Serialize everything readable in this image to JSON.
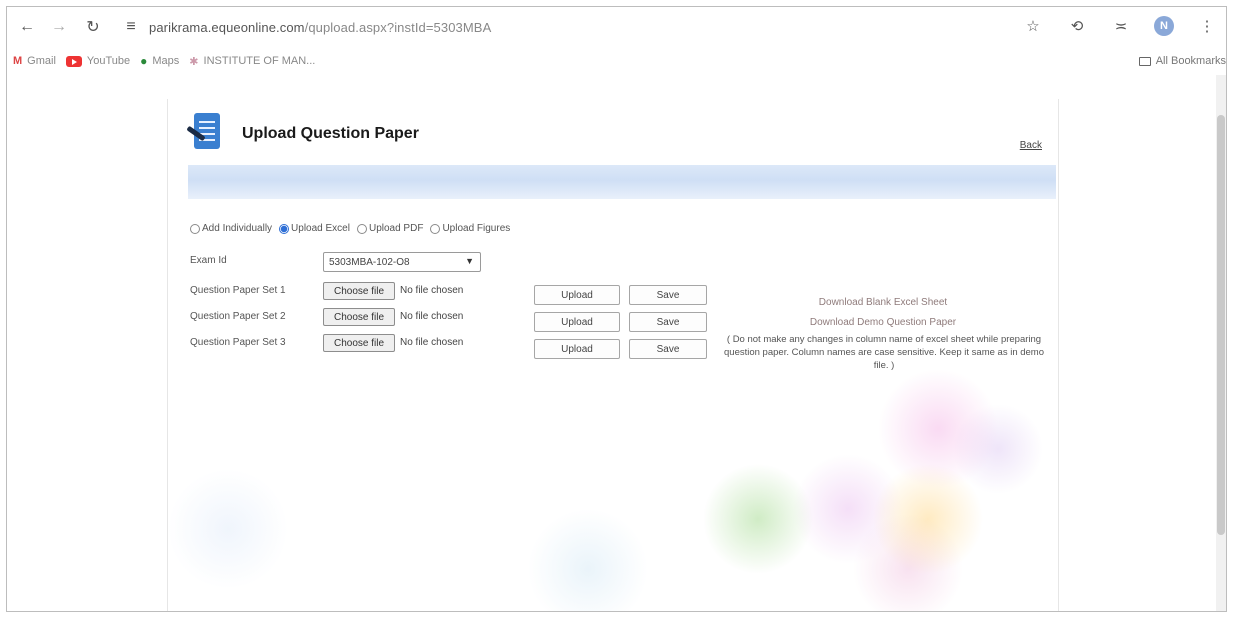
{
  "browser": {
    "url_domain": "parikrama.equeonline.com",
    "url_path": "/qupload.aspx?instId=5303MBA",
    "avatar_letter": "N",
    "bookmarks": [
      {
        "label": "Gmail"
      },
      {
        "label": "YouTube"
      },
      {
        "label": "Maps"
      },
      {
        "label": "INSTITUTE OF MAN..."
      }
    ],
    "all_bookmarks_label": "All Bookmarks"
  },
  "page": {
    "title": "Upload Question Paper",
    "back_label": "Back",
    "upload_modes": [
      {
        "label": "Add Individually",
        "checked": false
      },
      {
        "label": "Upload Excel",
        "checked": true
      },
      {
        "label": "Upload PDF",
        "checked": false
      },
      {
        "label": "Upload Figures",
        "checked": false
      }
    ],
    "exam_id_label": "Exam Id",
    "exam_id_value": "5303MBA-102-O8",
    "paper_sets": [
      {
        "label": "Question Paper Set 1",
        "choose_label": "Choose file",
        "status": "No file chosen",
        "upload_label": "Upload",
        "save_label": "Save"
      },
      {
        "label": "Question Paper Set 2",
        "choose_label": "Choose file",
        "status": "No file chosen",
        "upload_label": "Upload",
        "save_label": "Save"
      },
      {
        "label": "Question Paper Set 3",
        "choose_label": "Choose file",
        "status": "No file chosen",
        "upload_label": "Upload",
        "save_label": "Save"
      }
    ],
    "download_blank_label": "Download Blank Excel Sheet",
    "download_demo_label": "Download Demo Question Paper",
    "note": "( Do not make any changes in column name of excel sheet while preparing question paper. Column names are case sensitive. Keep it same as in demo file. )"
  },
  "colors": {
    "accent": "#2f6fd6",
    "header_bar": "#cfdff5",
    "link_muted": "#8f7b7b"
  }
}
